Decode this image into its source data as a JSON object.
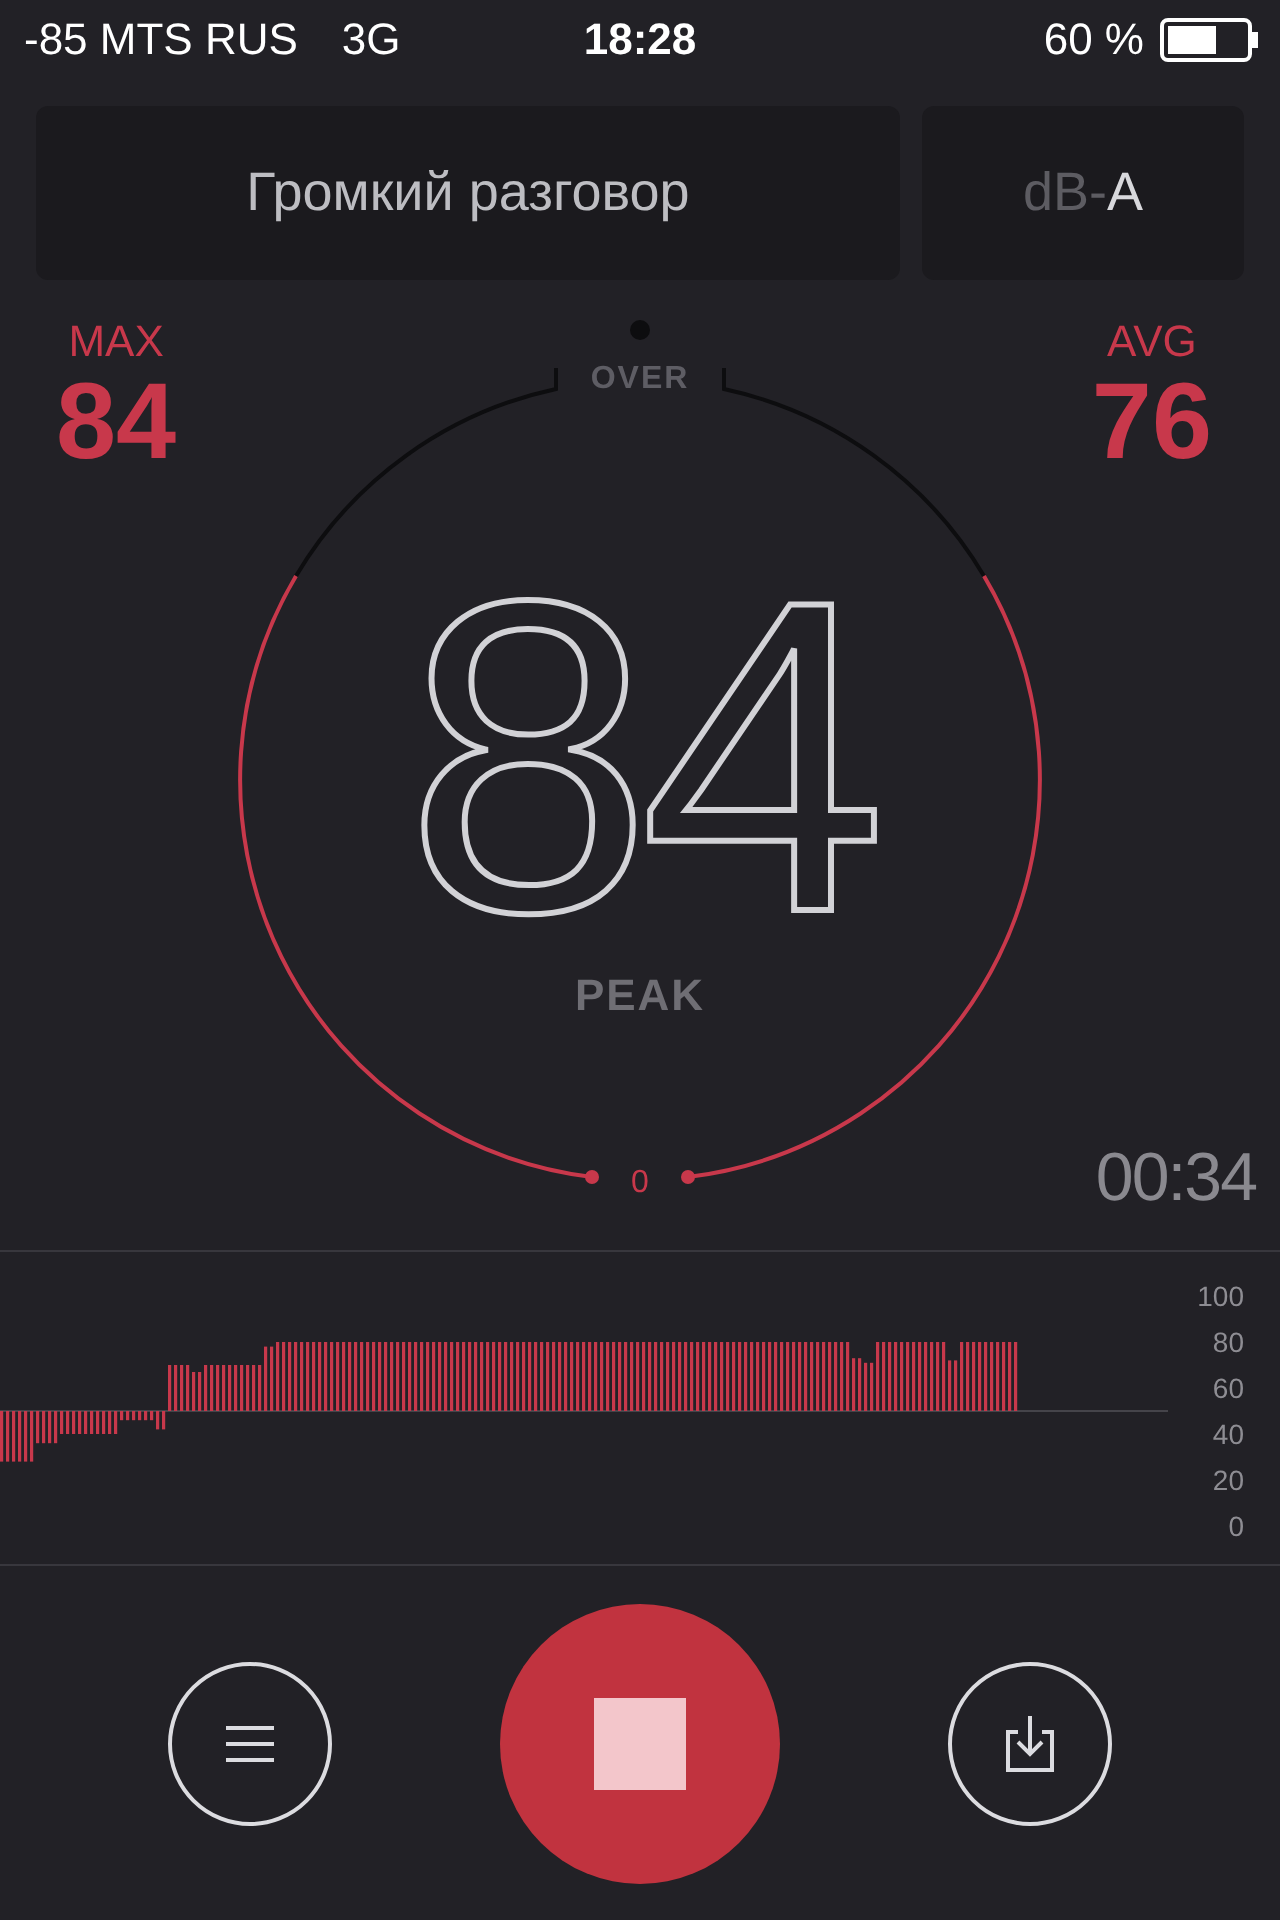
{
  "status_bar": {
    "carrier": "-85 MTS RUS",
    "network": "3G",
    "time": "18:28",
    "battery": "60 %"
  },
  "header": {
    "mode": "Громкий разговор",
    "weighting_prefix": "dB-",
    "weighting": "A"
  },
  "stats": [
    {
      "label": "MAX",
      "value": "84"
    },
    {
      "label": "AVG",
      "value": "76"
    }
  ],
  "gauge": {
    "over_label": "OVER",
    "reading": "84",
    "reading_label": "PEAK",
    "zero_label": "0"
  },
  "timer": "00:34",
  "history": {
    "tick_labels": [
      "100",
      "80",
      "60",
      "40",
      "20",
      "0"
    ]
  },
  "controls": [
    {
      "kind": "menu"
    },
    {
      "kind": "stop"
    },
    {
      "kind": "export"
    }
  ]
}
